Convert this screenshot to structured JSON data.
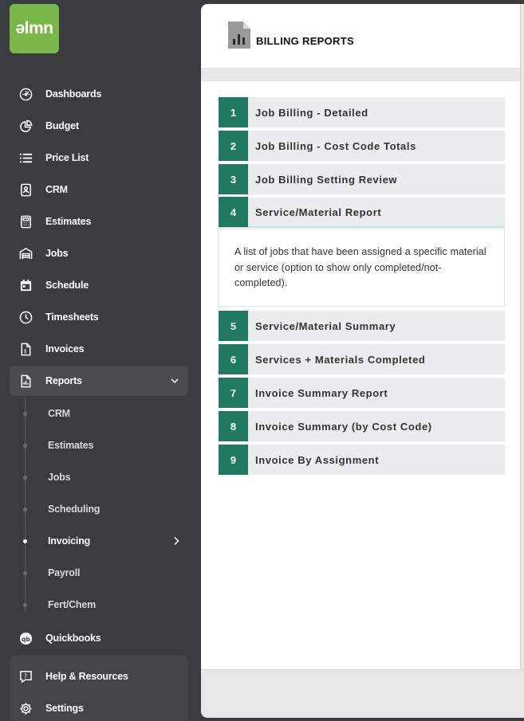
{
  "app": {
    "logo_text": "ǝlmn",
    "brand_color": "#7ab648",
    "accent_color": "#1f7a61"
  },
  "sidebar": {
    "items": [
      {
        "label": "Dashboards",
        "icon": "gauge-icon"
      },
      {
        "label": "Budget",
        "icon": "pie-chart-icon"
      },
      {
        "label": "Price List",
        "icon": "list-icon"
      },
      {
        "label": "CRM",
        "icon": "contact-card-icon"
      },
      {
        "label": "Estimates",
        "icon": "calculator-icon"
      },
      {
        "label": "Jobs",
        "icon": "garage-icon"
      },
      {
        "label": "Schedule",
        "icon": "calendar-icon"
      },
      {
        "label": "Timesheets",
        "icon": "clock-icon"
      },
      {
        "label": "Invoices",
        "icon": "invoice-icon"
      },
      {
        "label": "Reports",
        "icon": "report-icon"
      }
    ],
    "reports_sub": [
      "CRM",
      "Estimates",
      "Jobs",
      "Scheduling",
      "Invoicing",
      "Payroll",
      "Fert/Chem"
    ],
    "quickbooks": {
      "label": "Quickbooks",
      "icon": "quickbooks-icon"
    },
    "bottom": [
      {
        "label": "Help & Resources",
        "icon": "help-icon"
      },
      {
        "label": "Settings",
        "icon": "gear-icon"
      }
    ]
  },
  "page": {
    "title": "BILLING REPORTS",
    "reports": [
      {
        "num": "1",
        "label": "Job Billing - Detailed"
      },
      {
        "num": "2",
        "label": "Job Billing - Cost Code Totals"
      },
      {
        "num": "3",
        "label": "Job Billing Setting Review"
      },
      {
        "num": "4",
        "label": "Service/Material Report"
      },
      {
        "num": "5",
        "label": "Service/Material Summary"
      },
      {
        "num": "6",
        "label": "Services + Materials Completed"
      },
      {
        "num": "7",
        "label": "Invoice Summary Report"
      },
      {
        "num": "8",
        "label": "Invoice Summary (by Cost Code)"
      },
      {
        "num": "9",
        "label": "Invoice By Assignment"
      }
    ],
    "expanded_description": "A list of jobs that have been assigned a specific material or service (option to show only completed/not-completed)."
  }
}
